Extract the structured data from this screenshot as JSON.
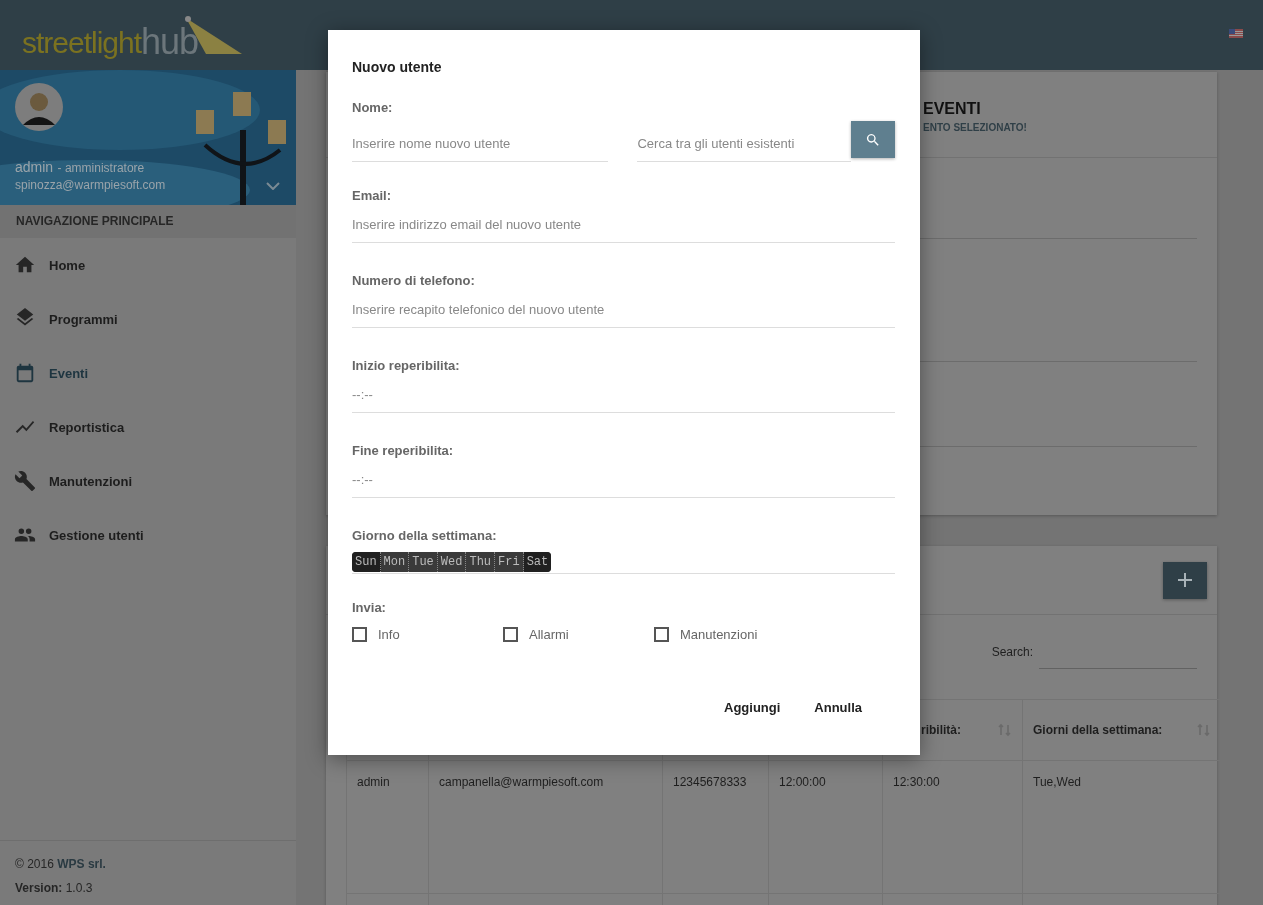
{
  "header": {
    "logo_main": "streetlight",
    "logo_accent": "hub"
  },
  "sidebar": {
    "user_name": "admin",
    "user_role": "- amministratore",
    "user_email": "spinozza@warmpiesoft.com",
    "nav_title": "NAVIGAZIONE PRINCIPALE",
    "items": [
      {
        "label": "Home",
        "selected": false
      },
      {
        "label": "Programmi",
        "selected": false
      },
      {
        "label": "Eventi",
        "selected": true
      },
      {
        "label": "Reportistica",
        "selected": false
      },
      {
        "label": "Manutenzioni",
        "selected": false
      },
      {
        "label": "Gestione utenti",
        "selected": false
      }
    ],
    "footer": {
      "copyright": "© 2016",
      "company": "WPS srl.",
      "version_label": "Version:",
      "version": "1.0.3"
    }
  },
  "events_card": {
    "title": "EVENTI",
    "subtitle": "ENTO SELEZIONATO!"
  },
  "users_card": {
    "search_label": "Search:",
    "columns": [
      "",
      "",
      "",
      "",
      "ribilità:",
      "Giorni della settimana:"
    ],
    "rows": [
      [
        "admin",
        "campanella@warmpiesoft.com",
        "12345678333",
        "12:00:00",
        "12:30:00",
        "Tue,Wed"
      ]
    ]
  },
  "dialog": {
    "title": "Nuovo utente",
    "name_label": "Nome:",
    "name_placeholder": "Inserire nome nuovo utente",
    "search_placeholder": "Cerca tra gli utenti esistenti",
    "fields": [
      {
        "label": "Email:",
        "placeholder": "Inserire indirizzo email del nuovo utente"
      },
      {
        "label": "Numero di telefono:",
        "placeholder": "Inserire recapito telefonico del nuovo utente"
      },
      {
        "label": "Inizio reperibilita:",
        "placeholder": "--:--"
      },
      {
        "label": "Fine reperibilita:",
        "placeholder": "--:--"
      }
    ],
    "days_label": "Giorno della settimana:",
    "days": [
      {
        "label": "Sun",
        "selected": true
      },
      {
        "label": "Mon",
        "selected": false
      },
      {
        "label": "Tue",
        "selected": false
      },
      {
        "label": "Wed",
        "selected": false
      },
      {
        "label": "Thu",
        "selected": false
      },
      {
        "label": "Fri",
        "selected": false
      },
      {
        "label": "Sat",
        "selected": true
      }
    ],
    "send_label": "Invia:",
    "send_options": [
      {
        "label": "Info",
        "checked": false
      },
      {
        "label": "Allarmi",
        "checked": false
      },
      {
        "label": "Manutenzioni",
        "checked": false
      }
    ],
    "buttons": [
      "Aggiungi",
      "Annulla"
    ]
  }
}
